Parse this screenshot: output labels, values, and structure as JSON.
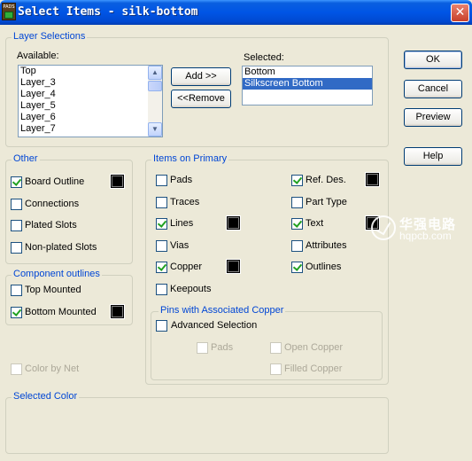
{
  "window": {
    "title": "Select Items - silk-bottom",
    "app_icon_text": "PADS",
    "close_glyph": "✕"
  },
  "layer_selections": {
    "group_label": "Layer Selections",
    "available_label": "Available:",
    "available_items": [
      "Top",
      "Layer_3",
      "Layer_4",
      "Layer_5",
      "Layer_6",
      "Layer_7"
    ],
    "selected_label": "Selected:",
    "selected_items": [
      "Bottom",
      "Silkscreen Bottom"
    ],
    "selected_highlight": "Silkscreen Bottom",
    "add_button": "Add >>",
    "remove_button": "<<Remove"
  },
  "buttons": {
    "ok": "OK",
    "cancel": "Cancel",
    "preview": "Preview",
    "help": "Help"
  },
  "other": {
    "group_label": "Other",
    "items": [
      {
        "label": "Board Outline",
        "checked": true,
        "color": "#000000"
      },
      {
        "label": "Connections",
        "checked": false
      },
      {
        "label": "Plated Slots",
        "checked": false
      },
      {
        "label": "Non-plated Slots",
        "checked": false
      }
    ]
  },
  "component_outlines": {
    "group_label": "Component outlines",
    "items": [
      {
        "label": "Top Mounted",
        "checked": false
      },
      {
        "label": "Bottom Mounted",
        "checked": true,
        "color": "#000000"
      }
    ]
  },
  "color_by_net": {
    "label": "Color by Net",
    "checked": false,
    "enabled": false
  },
  "items_on_primary": {
    "group_label": "Items on Primary",
    "left": [
      {
        "label": "Pads",
        "checked": false
      },
      {
        "label": "Traces",
        "checked": false
      },
      {
        "label": "Lines",
        "checked": true,
        "color": "#000000"
      },
      {
        "label": "Vias",
        "checked": false
      },
      {
        "label": "Copper",
        "checked": true,
        "color": "#000000"
      },
      {
        "label": "Keepouts",
        "checked": false
      }
    ],
    "right": [
      {
        "label": "Ref. Des.",
        "checked": true,
        "color": "#000000"
      },
      {
        "label": "Part Type",
        "checked": false
      },
      {
        "label": "Text",
        "checked": true,
        "color": "#000000"
      },
      {
        "label": "Attributes",
        "checked": false
      },
      {
        "label": "Outlines",
        "checked": true
      }
    ]
  },
  "pins_copper": {
    "group_label": "Pins with Associated Copper",
    "advanced_selection": "Advanced Selection",
    "pads": "Pads",
    "open_copper": "Open Copper",
    "filled_copper": "Filled Copper"
  },
  "selected_color": {
    "group_label": "Selected Color"
  },
  "watermark": {
    "cn": "华强电路",
    "url": "hqpcb.com"
  }
}
